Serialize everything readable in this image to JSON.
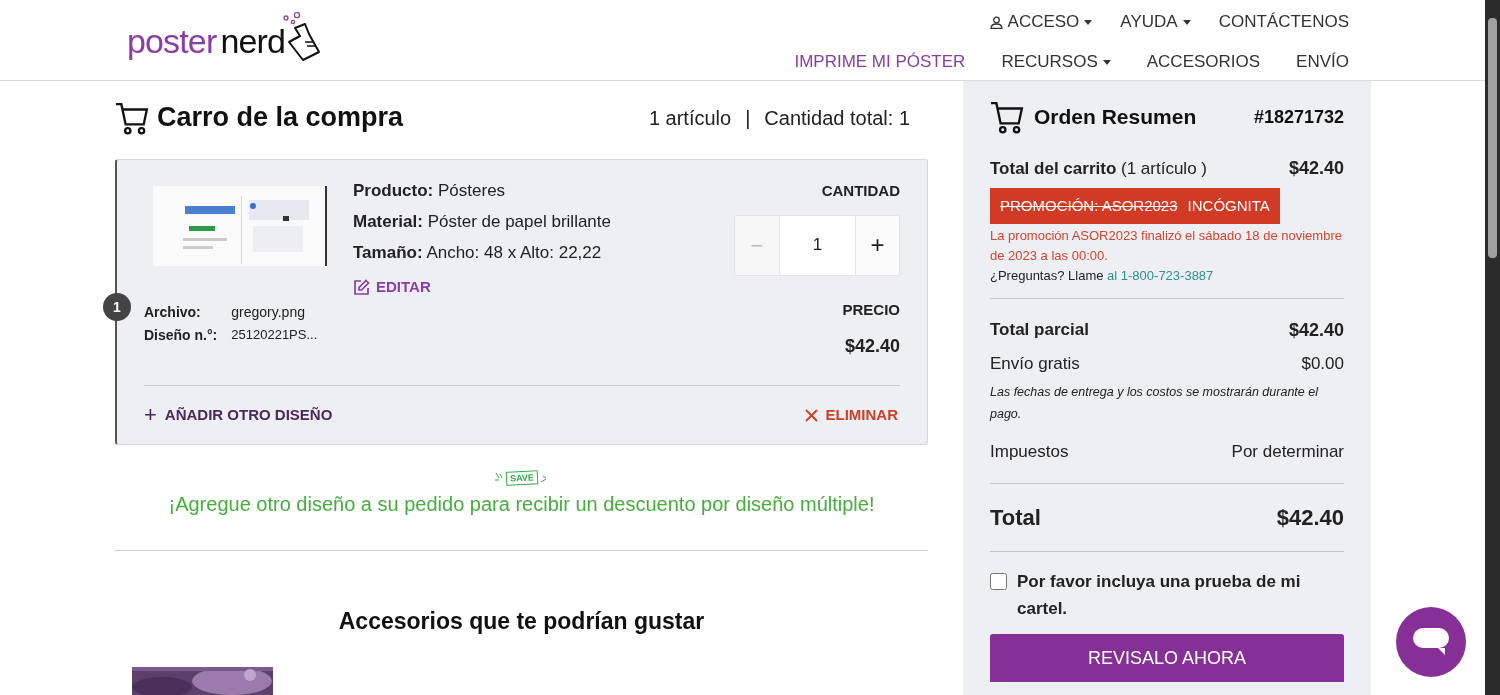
{
  "header": {
    "logo": {
      "part_1": "poster",
      "part_2": "nerd"
    },
    "top_nav": [
      {
        "label": "ACCESO",
        "kind": "account",
        "dropdown": true
      },
      {
        "label": "AYUDA",
        "kind": "plain",
        "dropdown": true
      },
      {
        "label": "CONTÁCTENOS",
        "kind": "plain",
        "dropdown": false
      }
    ],
    "main_nav": [
      {
        "label": "IMPRIME MI PÓSTER",
        "selected": true,
        "dropdown": false
      },
      {
        "label": "RECURSOS",
        "selected": false,
        "dropdown": true
      },
      {
        "label": "ACCESORIOS",
        "selected": false,
        "dropdown": false
      },
      {
        "label": "ENVÍO",
        "selected": false,
        "dropdown": false
      }
    ]
  },
  "cart": {
    "title": "Carro de la compra",
    "item_count": "1 artículo",
    "separator": "|",
    "total_quantity": "Cantidad total: 1",
    "items": [
      {
        "badge": "1",
        "file": {
          "label": "Archivo:",
          "value": "gregory.png"
        },
        "design_no": {
          "label": "Diseño n.°:",
          "value": "25120221PS..."
        },
        "details": [
          {
            "label": "Producto:",
            "value": "Pósteres"
          },
          {
            "label": "Material:",
            "value": "Póster de papel brillante"
          },
          {
            "label": "Tamaño:",
            "value": "Ancho: 48 x Alto: 22,22"
          }
        ],
        "edit": "EDITAR",
        "quantity_label": "CANTIDAD",
        "decrement": "−",
        "quantity": "1",
        "increment": "+",
        "decrement_disabled": true,
        "price_label": "PRECIO",
        "price": "$42.40",
        "add_design": "AÑADIR OTRO DISEÑO",
        "add_icon": "+",
        "remove": "ELIMINAR"
      }
    ],
    "promo": {
      "badge": "SAVE",
      "message": "¡Agregue otro diseño a su pedido para recibir un descuento por diseño múltiple!"
    },
    "accessories": {
      "title": "Accesorios que te podrían gustar"
    }
  },
  "summary": {
    "title": "Orden Resumen",
    "order_number": "#18271732",
    "cart_total": {
      "label": "Total del carrito",
      "note": "(1 artículo )",
      "value": "$42.40"
    },
    "promotion": {
      "code": "PROMOCIÓN: ASOR2023",
      "status": "INCÓGNITA",
      "expired": true,
      "message": "La promoción ASOR2023 finalizó el sábado 18 de noviembre de 2023 a las 00:00."
    },
    "questions": {
      "text": "¿Preguntas? Llame",
      "link": "al 1-800-723-3887"
    },
    "lines": [
      {
        "label": "Total parcial",
        "value": "$42.40",
        "kind": "bold"
      },
      {
        "label": "Envío gratis",
        "value": "$0.00",
        "kind": "plain",
        "note": "Las fechas de entrega y los costos se mostrarán durante el pago."
      },
      {
        "label": "Impuestos",
        "value": "Por determinar",
        "kind": "plain"
      }
    ],
    "total": {
      "label": "Total",
      "value": "$42.40"
    },
    "proof": {
      "label": "Por favor incluya una prueba de mi cartel.",
      "checked": false
    },
    "button": "REVISALO AHORA"
  }
}
